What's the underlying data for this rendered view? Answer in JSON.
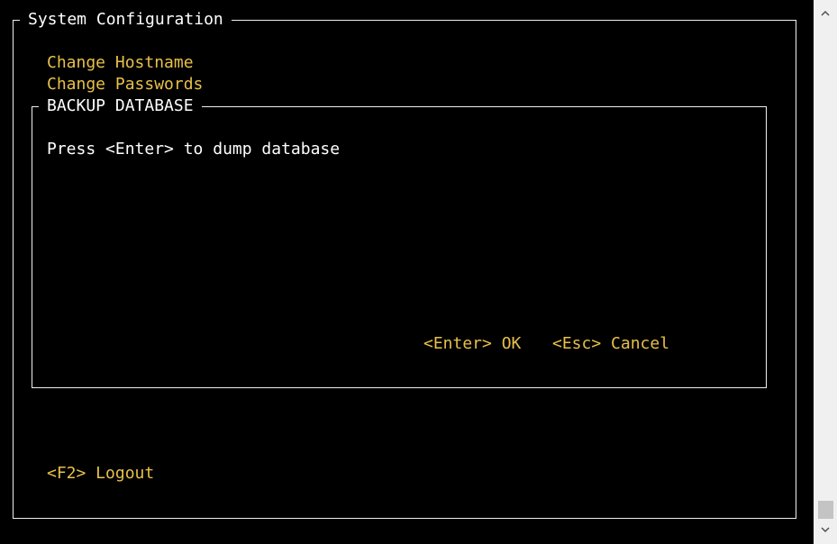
{
  "window": {
    "title": "System Configuration"
  },
  "menu": {
    "items": [
      {
        "label": "Change Hostname"
      },
      {
        "label": "Change Passwords"
      }
    ]
  },
  "dialog": {
    "title": "BACKUP DATABASE",
    "message": "Press <Enter> to dump database",
    "ok_label": "<Enter> OK",
    "cancel_label": "<Esc> Cancel"
  },
  "footer": {
    "logout_label": "<F2> Logout"
  },
  "colors": {
    "background": "#000000",
    "text": "#ffffff",
    "accent": "#e8c04a",
    "border": "#f0f0f0"
  },
  "scrollbar": {
    "up_icon": "chevron-up-icon",
    "down_icon": "chevron-down-icon"
  }
}
